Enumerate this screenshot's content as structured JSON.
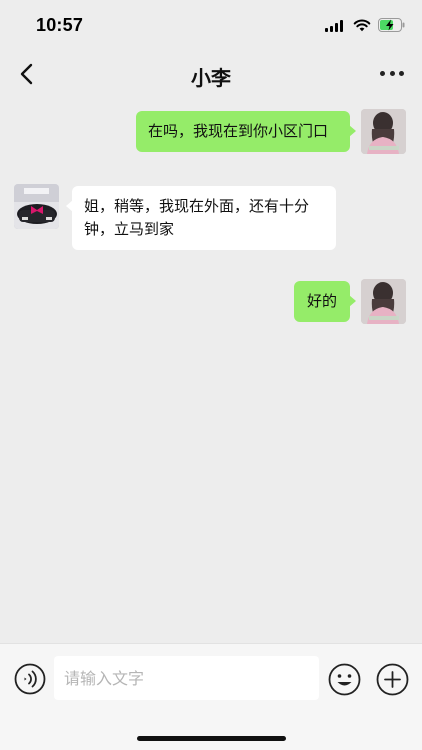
{
  "status_bar": {
    "time": "10:57",
    "battery_state": "charging"
  },
  "header": {
    "title": "小李"
  },
  "messages": [
    {
      "direction": "outgoing",
      "text": "在吗，我现在到你小区门口"
    },
    {
      "direction": "incoming",
      "text": "姐，稍等，我现在外面，还有十分钟，立马到家"
    },
    {
      "direction": "outgoing",
      "text": "好的"
    }
  ],
  "input_bar": {
    "placeholder": "请输入文字",
    "value": ""
  },
  "colors": {
    "background": "#ededed",
    "outgoing_bubble": "#95ec69",
    "incoming_bubble": "#ffffff",
    "battery_charge": "#4cd964"
  }
}
